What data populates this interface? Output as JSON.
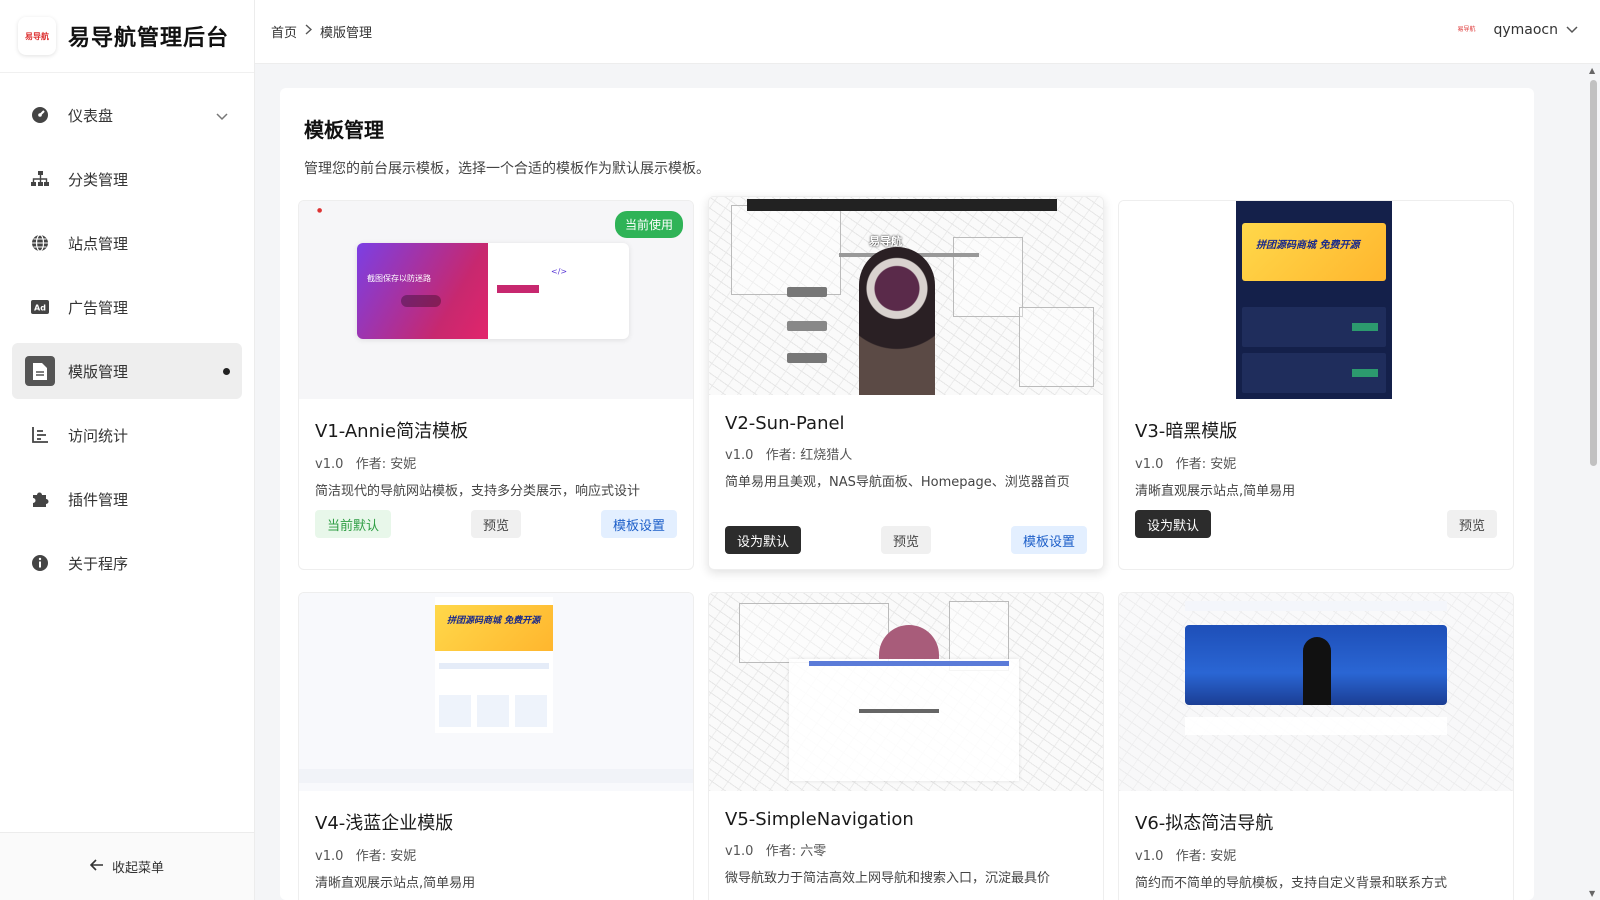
{
  "brand": {
    "logo_text": "易导航",
    "title": "易导航管理后台"
  },
  "sidebar": {
    "items": [
      {
        "label": "仪表盘",
        "icon": "dashboard-icon"
      },
      {
        "label": "分类管理",
        "icon": "sitemap-icon"
      },
      {
        "label": "站点管理",
        "icon": "globe-icon"
      },
      {
        "label": "广告管理",
        "icon": "ad-icon"
      },
      {
        "label": "模版管理",
        "icon": "file-icon",
        "active": true
      },
      {
        "label": "访问统计",
        "icon": "chart-icon"
      },
      {
        "label": "插件管理",
        "icon": "puzzle-icon"
      },
      {
        "label": "关于程序",
        "icon": "info-icon"
      }
    ],
    "collapse_label": "收起菜单"
  },
  "header": {
    "breadcrumb": [
      "首页",
      "模版管理"
    ],
    "user": {
      "avatar_text": "易导航",
      "name": "qymaocn"
    }
  },
  "page": {
    "title": "模板管理",
    "description": "管理您的前台展示模板，选择一个合适的模板作为默认展示模板。"
  },
  "templates": [
    {
      "title": "V1-Annie简洁模板",
      "version": "v1.0",
      "author": "作者: 安妮",
      "desc": "简洁现代的导航网站模板，支持多分类展示，响应式设计",
      "badge": "当前使用",
      "actions": [
        "当前默认",
        "预览",
        "模板设置"
      ]
    },
    {
      "title": "V2-Sun-Panel",
      "version": "v1.0",
      "author": "作者: 红烧猎人",
      "desc": "简单易用且美观，NAS导航面板、Homepage、浏览器首页",
      "actions": [
        "设为默认",
        "预览",
        "模板设置"
      ]
    },
    {
      "title": "V3-暗黑模版",
      "version": "v1.0",
      "author": "作者: 安妮",
      "desc": "清晰直观展示站点,简单易用",
      "actions": [
        "设为默认",
        "预览"
      ]
    },
    {
      "title": "V4-浅蓝企业模版",
      "version": "v1.0",
      "author": "作者: 安妮",
      "desc": "清晰直观展示站点,简单易用"
    },
    {
      "title": "V5-SimpleNavigation",
      "version": "v1.0",
      "author": "作者: 六零",
      "desc": "微导航致力于简洁高效上网导航和搜索入口，沉淀最具价"
    },
    {
      "title": "V6-拟态简洁导航",
      "version": "v1.0",
      "author": "作者: 安妮",
      "desc": "简约而不简单的导航模板，支持自定义背景和联系方式"
    }
  ],
  "thumb_text": {
    "v1_banner": "截图保存以防迷路",
    "v2_brand": "易导航",
    "v3_banner": "拼团源码商城 免费开源",
    "v4_banner": "拼团源码商城 免费开源"
  },
  "colors": {
    "accent_green": "#2fb357",
    "accent_blue": "#1d5fc9",
    "dark_button": "#2c2c2c"
  }
}
